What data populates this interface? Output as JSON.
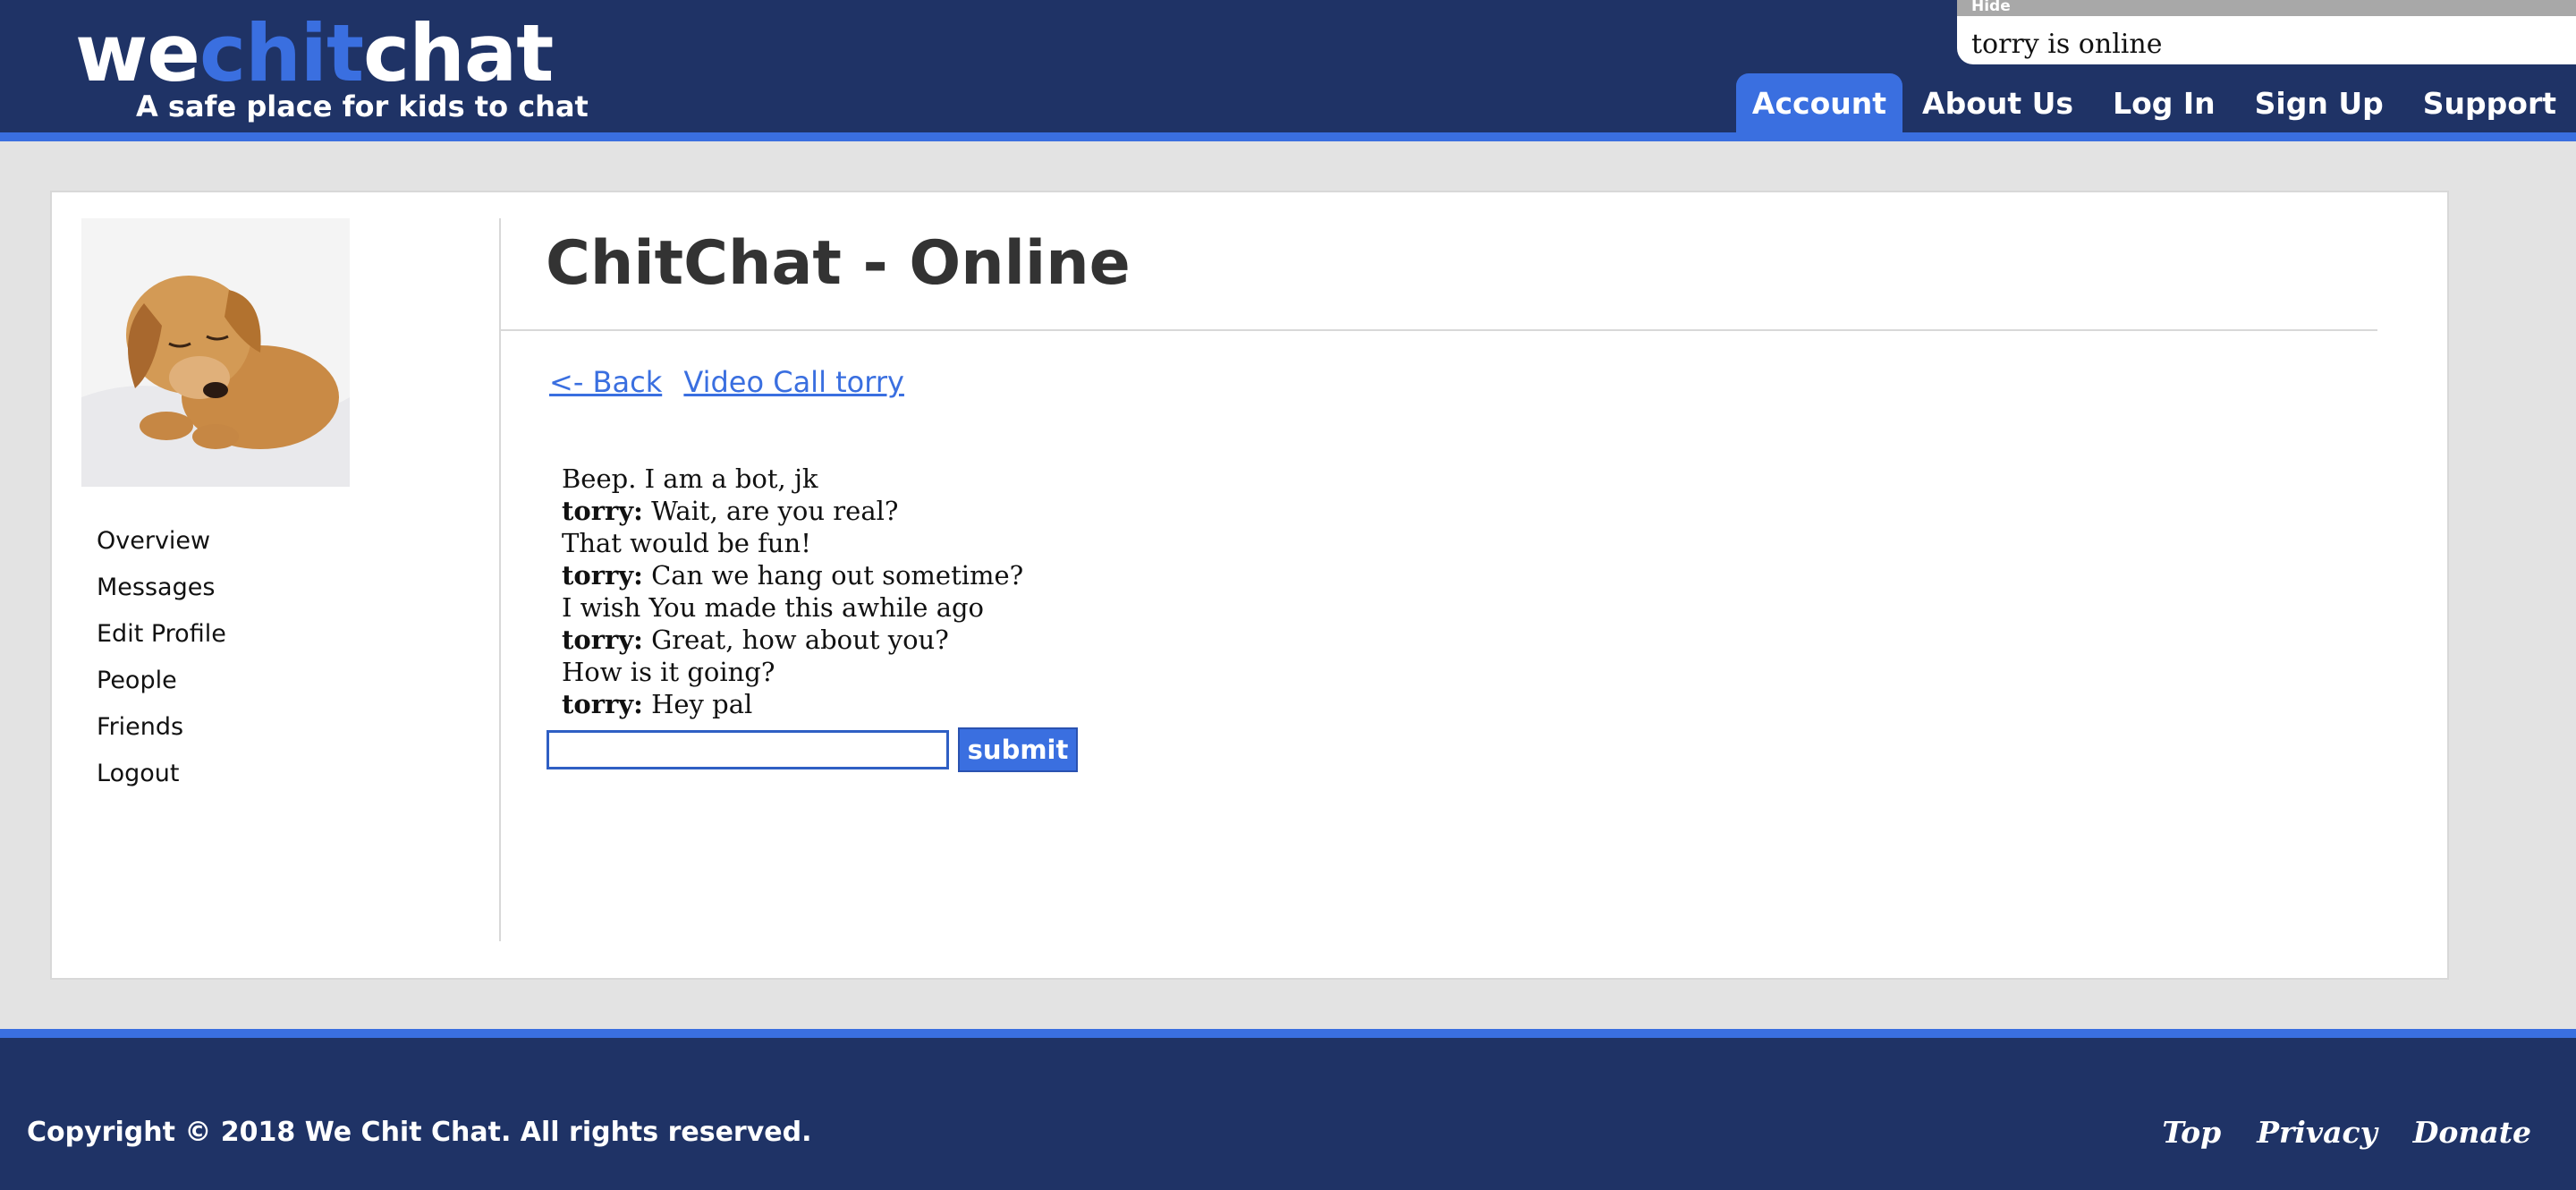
{
  "header": {
    "logo": {
      "part1": "we",
      "part2": "chit",
      "part3": "chat"
    },
    "tagline": "A safe place for kids to chat",
    "status": {
      "hide_label": "Hide",
      "text": "torry is online"
    },
    "nav": [
      "Account",
      "About Us",
      "Log In",
      "Sign Up",
      "Support"
    ]
  },
  "sidebar": {
    "menu": [
      "Overview",
      "Messages",
      "Edit Profile",
      "People",
      "Friends",
      "Logout"
    ]
  },
  "main": {
    "title": "ChitChat - Online",
    "back_link": "<- Back",
    "video_call_link": "Video Call torry",
    "messages": [
      {
        "sender": "",
        "text": "Beep. I am a bot, jk"
      },
      {
        "sender": "torry:",
        "text": " Wait, are you real?"
      },
      {
        "sender": "",
        "text": "That would be fun!"
      },
      {
        "sender": "torry:",
        "text": " Can we hang out sometime?"
      },
      {
        "sender": "",
        "text": "I wish You made this awhile ago"
      },
      {
        "sender": "torry:",
        "text": " Great, how about you?"
      },
      {
        "sender": "",
        "text": "How is it going?"
      },
      {
        "sender": "torry:",
        "text": " Hey pal"
      }
    ],
    "input_value": "",
    "submit_label": "submit"
  },
  "footer": {
    "copyright": "Copyright © 2018 We Chit Chat. All rights reserved.",
    "links": [
      "Top",
      "Privacy",
      "Donate"
    ]
  },
  "colors": {
    "navy": "#1f3366",
    "accent_blue": "#3a6fe0",
    "background": "#e3e3e3"
  }
}
